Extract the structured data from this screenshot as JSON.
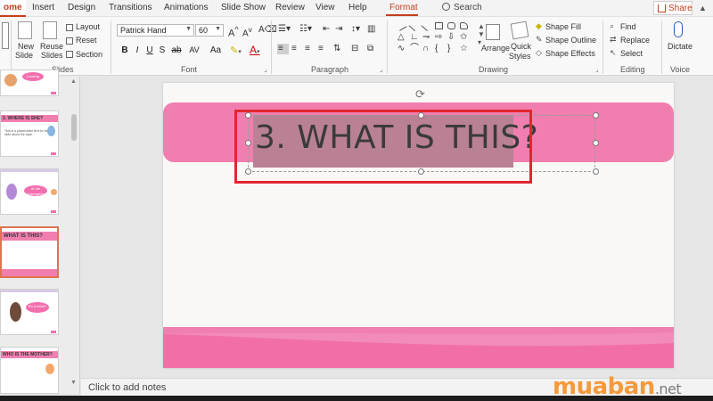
{
  "ribbon": {
    "tabs": [
      "ome",
      "Insert",
      "Design",
      "Transitions",
      "Animations",
      "Slide Show",
      "Review",
      "View",
      "Help",
      "Format"
    ],
    "active_tab": "ome",
    "search_label": "Search",
    "share_label": "Share",
    "slides_group": {
      "new_slide": "New",
      "new_slide_2": "Slide",
      "reuse": "Reuse",
      "reuse_2": "Slides",
      "layout": "Layout",
      "reset": "Reset",
      "section": "Section",
      "label": "Slides"
    },
    "font_group": {
      "font_name": "Patrick Hand",
      "font_size": "60",
      "bold": "B",
      "italic": "I",
      "underline": "U",
      "strike": "S",
      "shadow": "ab",
      "spacing": "AV",
      "case": "Aa",
      "label": "Font"
    },
    "paragraph_label": "Paragraph",
    "drawing_group": {
      "arrange": "Arrange",
      "quick_styles": "Quick",
      "quick_styles_2": "Styles",
      "shape_fill": "Shape Fill",
      "shape_outline": "Shape Outline",
      "shape_effects": "Shape Effects",
      "label": "Drawing"
    },
    "editing_group": {
      "find": "Find",
      "replace": "Replace",
      "select": "Select",
      "label": "Editing"
    },
    "voice_group": {
      "dictate": "Dictate",
      "label": "Voice"
    }
  },
  "thumbnails": [
    {
      "title": "",
      "has_figure": true,
      "bubble": "Looking",
      "selected": false
    },
    {
      "title": "2. WHERE IS SHE?",
      "text": "This is a placeholder text for the slide about the topic.",
      "selected": false
    },
    {
      "title": "",
      "bubble": "At the kindergarten",
      "selected": false
    },
    {
      "title": "WHAT IS THIS?",
      "selected": true
    },
    {
      "title": "",
      "bubble": "It's a table?",
      "selected": false
    },
    {
      "title": "WHO IS THE MOTHER?",
      "selected": false
    }
  ],
  "slide": {
    "title": "3. WHAT IS THIS?"
  },
  "notes_placeholder": "Click to add notes",
  "watermark": {
    "brand": "muaban",
    "suffix": ".net"
  },
  "colors": {
    "accent": "#c43e1c",
    "slide_pink": "#f07fb0",
    "highlight_red": "#e3262e",
    "watermark_orange": "#f59a3b"
  }
}
